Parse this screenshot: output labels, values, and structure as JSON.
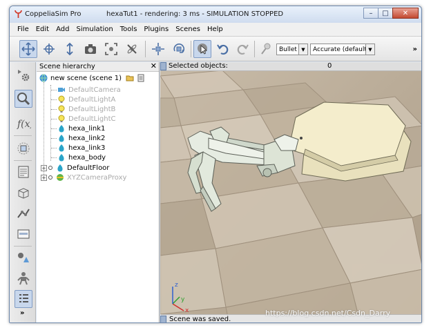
{
  "titlebar": {
    "app_name": "CoppeliaSim Pro",
    "document_title": "hexaTut1 - rendering: 3 ms - SIMULATION STOPPED",
    "minimize": "–",
    "maximize": "□",
    "close": "✕"
  },
  "menu": [
    "File",
    "Edit",
    "Add",
    "Simulation",
    "Tools",
    "Plugins",
    "Scenes",
    "Help"
  ],
  "toolbar": {
    "engine_select": "Bullet",
    "accuracy_select": "Accurate (default)",
    "more": "»"
  },
  "left_toolbar": {
    "more": "»"
  },
  "hierarchy": {
    "title": "Scene hierarchy",
    "close": "✕",
    "root": "new scene (scene 1)",
    "items": [
      {
        "label": "DefaultCamera",
        "icon": "camera-icon",
        "dim": true
      },
      {
        "label": "DefaultLightA",
        "icon": "light-icon",
        "dim": true
      },
      {
        "label": "DefaultLightB",
        "icon": "light-icon",
        "dim": true
      },
      {
        "label": "DefaultLightC",
        "icon": "light-icon",
        "dim": true
      },
      {
        "label": "hexa_link1",
        "icon": "shape-icon",
        "dim": false
      },
      {
        "label": "hexa_link2",
        "icon": "shape-icon",
        "dim": false
      },
      {
        "label": "hexa_link3",
        "icon": "shape-icon",
        "dim": false
      },
      {
        "label": "hexa_body",
        "icon": "shape-icon",
        "dim": false
      },
      {
        "label": "DefaultFloor",
        "icon": "shape-icon",
        "dim": false,
        "expandable": true
      },
      {
        "label": "XYZCameraProxy",
        "icon": "dummy-icon",
        "dim": true,
        "expandable": true
      }
    ]
  },
  "viewport": {
    "selected_label": "Selected objects:",
    "selected_count": "0",
    "status": "Scene was saved.",
    "axis_x": "x",
    "axis_y": "y",
    "axis_z": "z"
  },
  "watermark": "https://blog.csdn.net/Csdn_Darry",
  "colors": {
    "accent": "#7f9bc4",
    "floor_light": "#ccbfae",
    "floor_dark": "#a69682",
    "robot_body": "#f4edcc",
    "robot_limb": "#e4ebdf"
  }
}
